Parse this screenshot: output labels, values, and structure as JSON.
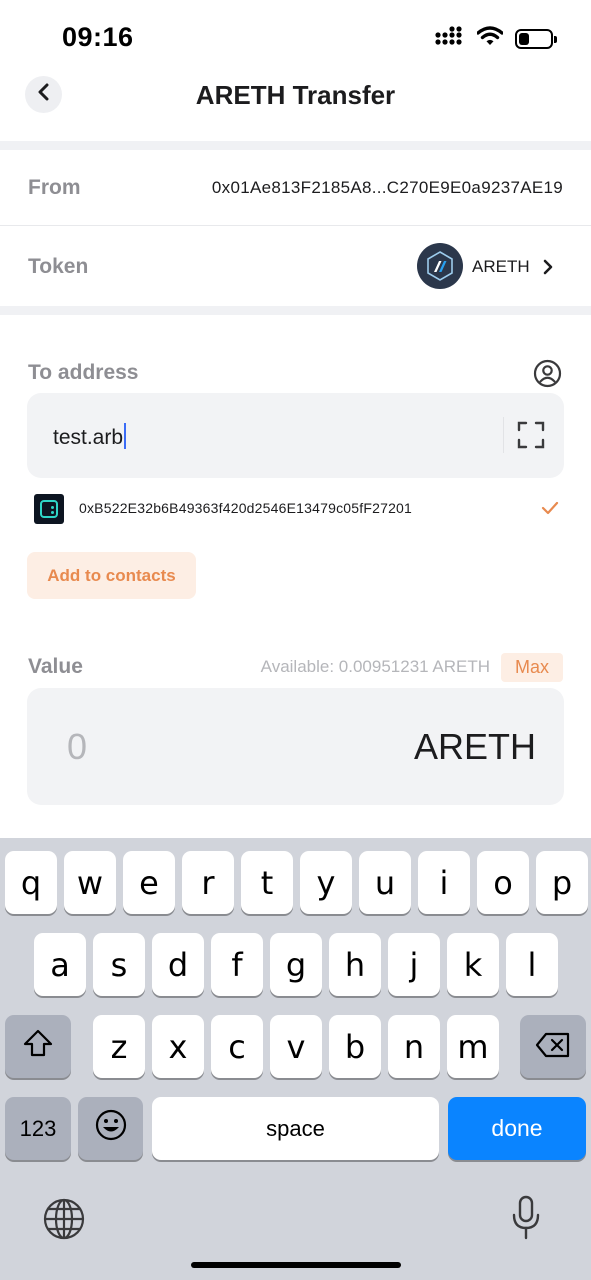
{
  "status_bar": {
    "time": "09:16",
    "icons": [
      "cellular-signal-icon",
      "wifi-icon",
      "battery-icon"
    ],
    "battery_level": 0.3
  },
  "header": {
    "title": "ARETH Transfer",
    "back_icon": "chevron-left-icon"
  },
  "form": {
    "from_label": "From",
    "from_value": "0x01Ae813F2185A8...C270E9E0a9237AE19",
    "token_label": "Token",
    "token_symbol": "ARETH",
    "token_icon": "arbitrum-logo-icon",
    "to_label": "To address",
    "to_value": "test.arb",
    "resolved_address": "0xB522E32b6B49363f420d2546E13479c05fF27201",
    "add_contacts_label": "Add to contacts",
    "value_label": "Value",
    "available_text": "Available: 0.00951231 ARETH",
    "max_label": "Max",
    "amount_placeholder": "0",
    "amount_unit": "ARETH"
  },
  "keyboard": {
    "row1": [
      "q",
      "w",
      "e",
      "r",
      "t",
      "y",
      "u",
      "i",
      "o",
      "p"
    ],
    "row2": [
      "a",
      "s",
      "d",
      "f",
      "g",
      "h",
      "j",
      "k",
      "l"
    ],
    "row3": [
      "z",
      "x",
      "c",
      "v",
      "b",
      "n",
      "m"
    ],
    "numbers_label": "123",
    "space_label": "space",
    "done_label": "done"
  },
  "colors": {
    "accent": "#e88a4f",
    "accent_bg": "#fdeee4",
    "keyboard_bg": "#d1d4db",
    "done_key": "#0a84ff",
    "label_gray": "#8e8e93"
  }
}
